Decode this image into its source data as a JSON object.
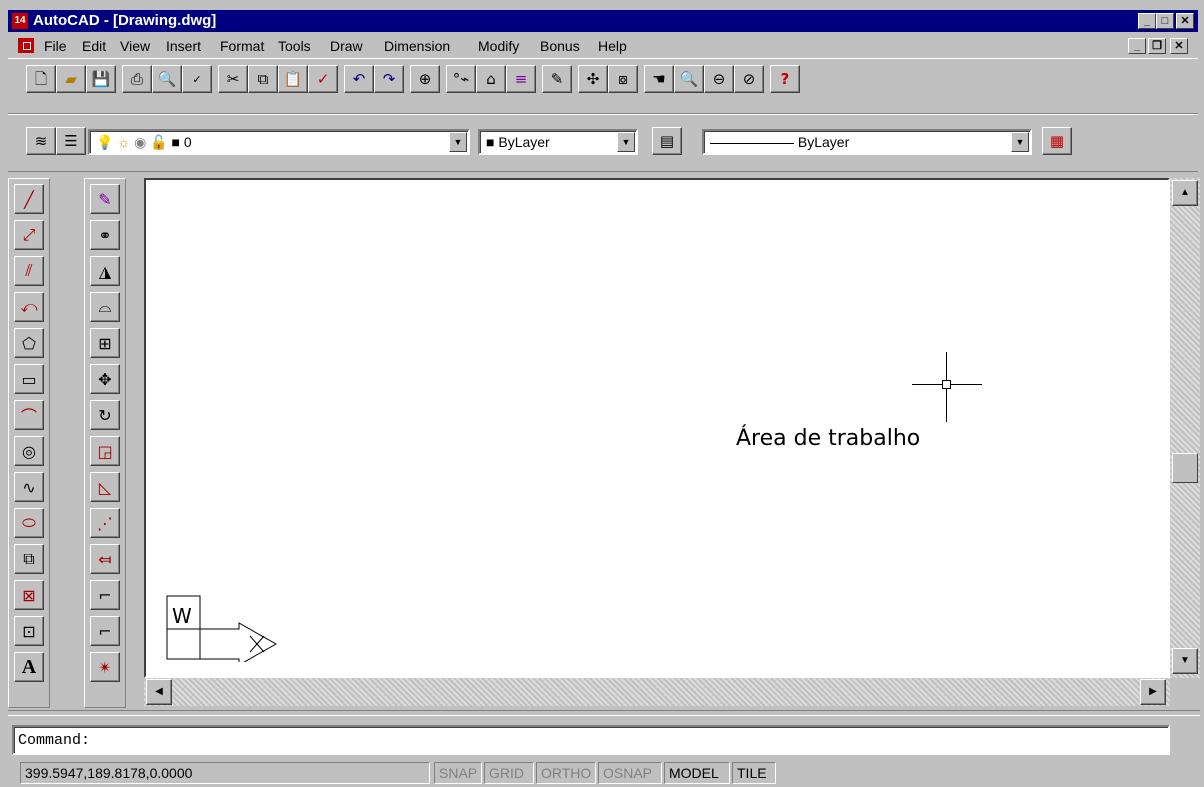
{
  "window": {
    "title": "AutoCAD - [Drawing.dwg]",
    "app_icon_text": "14"
  },
  "menu": [
    "File",
    "Edit",
    "View",
    "Insert",
    "Format",
    "Tools",
    "Draw",
    "Dimension",
    "Modify",
    "Bonus",
    "Help"
  ],
  "properties": {
    "layer": "0",
    "color": "ByLayer",
    "linetype": "ByLayer"
  },
  "drawing": {
    "annotation": "Área de trabalho",
    "ucs_label": "W"
  },
  "command": {
    "label": "Command:"
  },
  "status": {
    "coords": "399.5947,189.8178,0.0000",
    "toggles": [
      {
        "label": "SNAP",
        "active": false
      },
      {
        "label": "GRID",
        "active": false
      },
      {
        "label": "ORTHO",
        "active": false
      },
      {
        "label": "OSNAP",
        "active": false
      },
      {
        "label": "MODEL",
        "active": true
      },
      {
        "label": "TILE",
        "active": true
      }
    ]
  },
  "colors": {
    "titlebar": "#000080",
    "face": "#c0c0c0",
    "canvas": "#ffffff"
  }
}
